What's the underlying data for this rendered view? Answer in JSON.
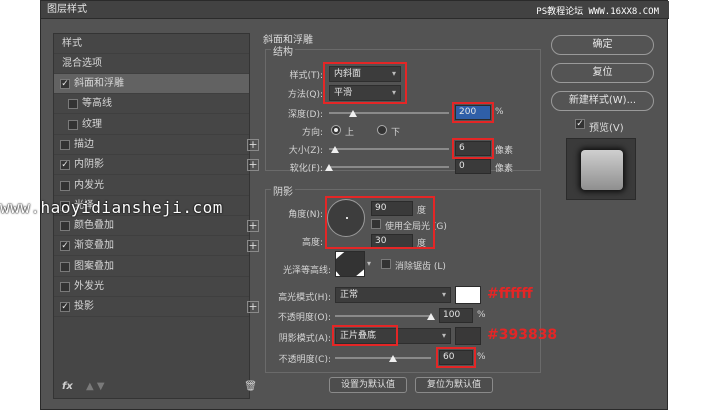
{
  "window": {
    "title": "图层样式",
    "watermark_top": "PS教程论坛 WWW.16XX8.COM"
  },
  "left": {
    "header": "样式",
    "blend": "混合选项",
    "items": [
      {
        "label": "斜面和浮雕",
        "checked": true,
        "selected": true,
        "sub": false,
        "plus": false
      },
      {
        "label": "等高线",
        "checked": false,
        "selected": false,
        "sub": true,
        "plus": false
      },
      {
        "label": "纹理",
        "checked": false,
        "selected": false,
        "sub": true,
        "plus": false
      },
      {
        "label": "描边",
        "checked": false,
        "selected": false,
        "sub": false,
        "plus": true
      },
      {
        "label": "内阴影",
        "checked": true,
        "selected": false,
        "sub": false,
        "plus": true
      },
      {
        "label": "内发光",
        "checked": false,
        "selected": false,
        "sub": false,
        "plus": false
      },
      {
        "label": "光泽",
        "checked": false,
        "selected": false,
        "sub": false,
        "plus": false
      },
      {
        "label": "颜色叠加",
        "checked": false,
        "selected": false,
        "sub": false,
        "plus": true
      },
      {
        "label": "渐变叠加",
        "checked": true,
        "selected": false,
        "sub": false,
        "plus": true
      },
      {
        "label": "图案叠加",
        "checked": false,
        "selected": false,
        "sub": false,
        "plus": false
      },
      {
        "label": "外发光",
        "checked": false,
        "selected": false,
        "sub": false,
        "plus": false
      },
      {
        "label": "投影",
        "checked": true,
        "selected": false,
        "sub": false,
        "plus": true
      }
    ],
    "fx": "fx",
    "arrows": "▲ ▼",
    "trash": "🗑"
  },
  "bevel": {
    "title": "斜面和浮雕",
    "structure": "结构",
    "style_label": "样式(T):",
    "style_value": "内斜面",
    "technique_label": "方法(Q):",
    "technique_value": "平滑",
    "depth_label": "深度(D):",
    "depth_value": "200",
    "depth_unit": "%",
    "depth_level": 0.2,
    "direction_label": "方向:",
    "dir_up": "上",
    "dir_down": "下",
    "size_label": "大小(Z):",
    "size_value": "6",
    "size_unit": "像素",
    "size_level": 0.05,
    "soften_label": "软化(F):",
    "soften_value": "0",
    "soften_unit": "像素",
    "soften_level": 0.0
  },
  "shading": {
    "title": "阴影",
    "angle_label": "角度(N):",
    "angle_value": "90",
    "angle_unit": "度",
    "global_light": "使用全局光 (G)",
    "altitude_label": "高度:",
    "altitude_value": "30",
    "altitude_unit": "度",
    "gloss_label": "光泽等高线:",
    "antialias": "消除锯齿 (L)",
    "highlight_label": "高光模式(H):",
    "highlight_mode": "正常",
    "highlight_color": "#ffffff",
    "highlight_annot": "#ffffff",
    "hl_opacity_label": "不透明度(O):",
    "hl_opacity_value": "100",
    "hl_opacity_unit": "%",
    "hl_opacity_level": 1.0,
    "shadow_label": "阴影模式(A):",
    "shadow_mode": "正片叠底",
    "shadow_color": "#393838",
    "shadow_annot": "#393838",
    "sh_opacity_label": "不透明度(C):",
    "sh_opacity_value": "60",
    "sh_opacity_unit": "%",
    "sh_opacity_level": 0.6
  },
  "footer": {
    "set_default": "设置为默认值",
    "reset_default": "复位为默认值"
  },
  "right": {
    "ok": "确定",
    "reset": "复位",
    "new_style": "新建样式(W)...",
    "preview": "预览(V)"
  },
  "overlay": {
    "watermark": "www.haoyidiansheji.com"
  }
}
